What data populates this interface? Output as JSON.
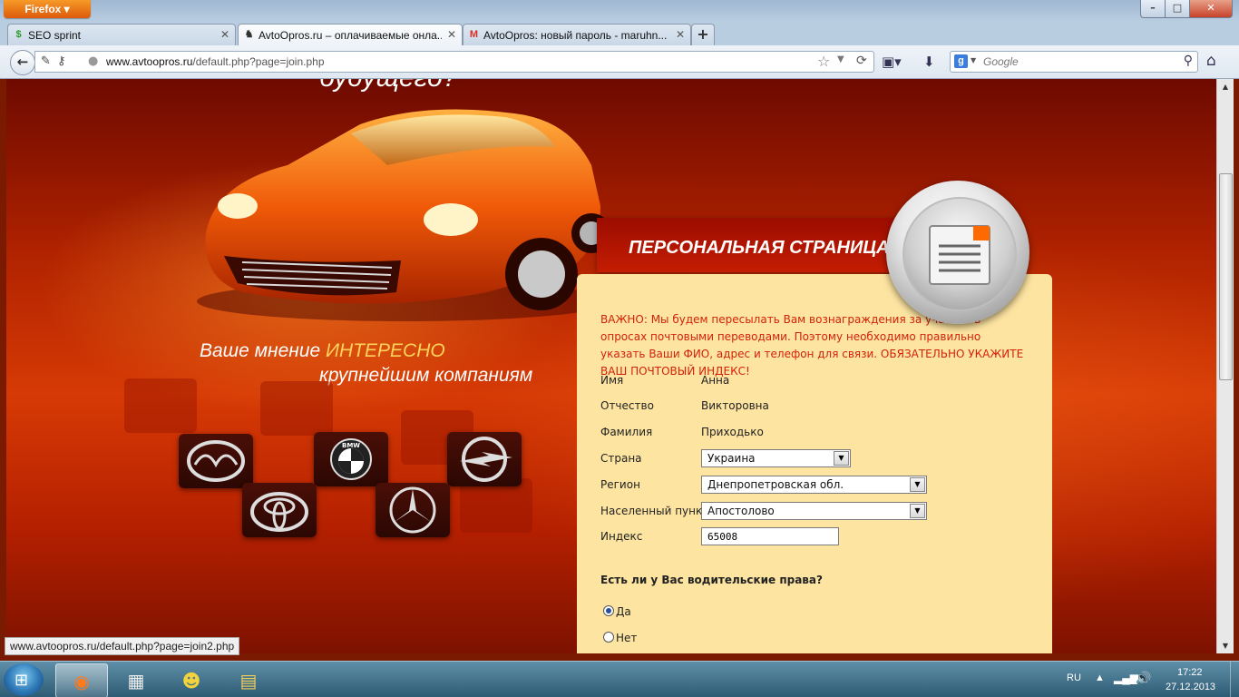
{
  "browser": {
    "menu_button": "Firefox ▾",
    "tabs": [
      {
        "title": "SEO sprint",
        "favicon": "$"
      },
      {
        "title": "AvtoOpros.ru – оплачиваемые онла...",
        "favicon": "♞"
      },
      {
        "title": "AvtoOpros: новый пароль - maruhn...",
        "favicon": "M"
      }
    ],
    "url_host": "www.avtoopros.ru",
    "url_path": "/default.php?page=join.php",
    "search_placeholder": "Google",
    "status_url": "www.avtoopros.ru/default.php?page=join2.php"
  },
  "hero": {
    "future_text": "будущего?",
    "slogan_line1_prefix": "Ваше мнение ",
    "slogan_line1_highlight": "ИНТЕРЕСНО",
    "slogan_line2": "крупнейшим компаниям"
  },
  "brands": [
    "mazda-logo",
    "bmw-logo",
    "opel-logo",
    "toyota-logo",
    "mercedes-logo"
  ],
  "personal": {
    "title": "ПЕРСОНАЛЬНАЯ СТРАНИЦА",
    "important": "ВАЖНО: Мы будем пересылать Вам вознаграждения за участие в опросах почтовыми переводами. Поэтому необходимо правильно указать Ваши ФИО, адрес и телефон для связи. ОБЯЗАТЕЛЬНО УКАЖИТЕ ВАШ ПОЧТОВЫЙ ИНДЕКС!",
    "fields": {
      "first_name_label": "Имя",
      "first_name": "Анна",
      "patronymic_label": "Отчество",
      "patronymic": "Викторовна",
      "last_name_label": "Фамилия",
      "last_name": "Приходько",
      "country_label": "Страна",
      "country": "Украина",
      "region_label": "Регион",
      "region": "Днепропетровская обл.",
      "city_label": "Населенный пункт",
      "city": "Апостолово",
      "index_label": "Индекс",
      "index": "65008"
    },
    "question": "Есть ли у Вас водительские права?",
    "options": [
      {
        "label": "Да",
        "checked": true
      },
      {
        "label": "Нет",
        "checked": false
      }
    ]
  },
  "taskbar": {
    "lang": "RU",
    "time": "17:22",
    "date": "27.12.2013"
  },
  "colors": {
    "accent_red": "#d4220a",
    "panel": "#fde4a1",
    "banner": "#b81600"
  }
}
